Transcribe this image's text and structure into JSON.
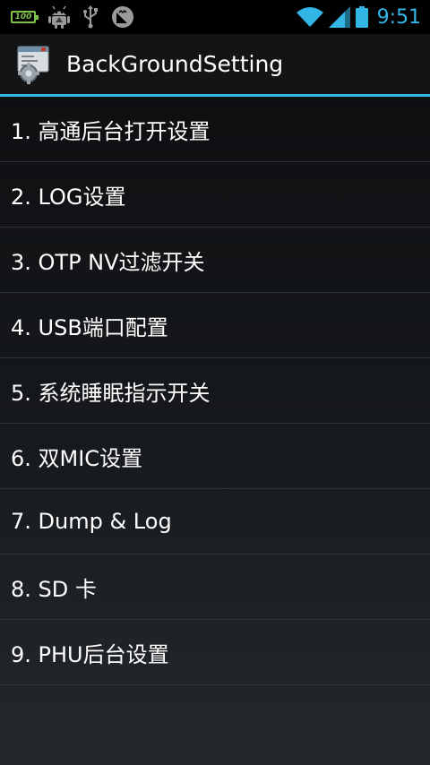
{
  "status_bar": {
    "battery_badge": "100",
    "time": "9:51",
    "icons": [
      "battery-100-icon",
      "android-debug-icon",
      "usb-icon",
      "sd-card-icon",
      "wifi-icon",
      "signal-icon",
      "battery-icon"
    ]
  },
  "action_bar": {
    "title": "BackGroundSetting",
    "icon": "settings-app-icon"
  },
  "menu": {
    "items": [
      {
        "label": "1. 高通后台打开设置"
      },
      {
        "label": "2. LOG设置"
      },
      {
        "label": "3. OTP NV过滤开关"
      },
      {
        "label": "4. USB端口配置"
      },
      {
        "label": "5. 系统睡眠指示开关"
      },
      {
        "label": "6. 双MIC设置"
      },
      {
        "label": "7. Dump & Log"
      },
      {
        "label": "8. SD 卡"
      },
      {
        "label": "9. PHU后台设置"
      }
    ]
  },
  "colors": {
    "accent": "#33b5e5",
    "background": "#101214",
    "divider": "#2e3236",
    "battery_green": "#7ec24a"
  }
}
